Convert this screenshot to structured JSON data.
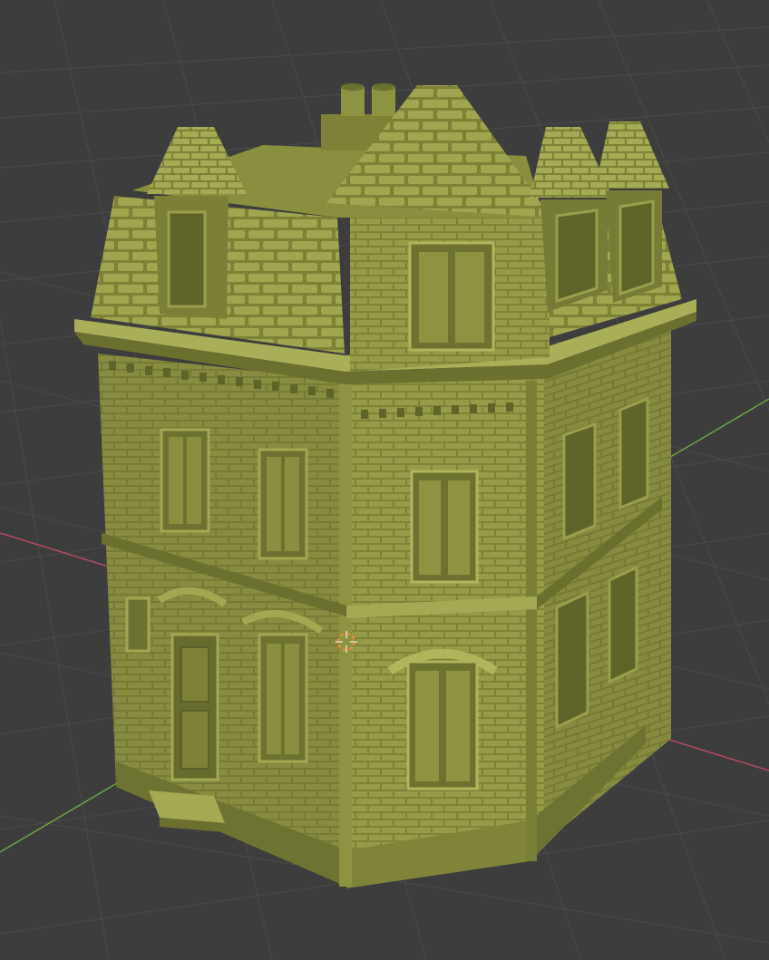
{
  "viewport": {
    "background": "#3d3d3d",
    "grid_color": "#4a4a4a",
    "x_axis_color": "#b34a5c",
    "y_axis_color": "#6aa341"
  },
  "model": {
    "subject": "building-model",
    "base_color": "#8a8f3f",
    "light_color": "#a8ad55",
    "shadow_color": "#5c602a"
  },
  "cursor": {
    "color": "#ff8a3a",
    "icon": "3d-cursor-icon"
  }
}
